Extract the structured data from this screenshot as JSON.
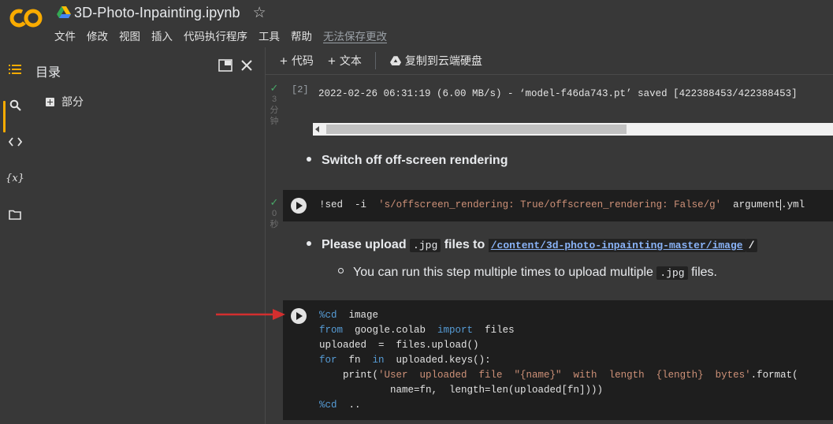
{
  "header": {
    "title": "3D-Photo-Inpainting.ipynb",
    "menu": [
      "文件",
      "修改",
      "视图",
      "插入",
      "代码执行程序",
      "工具",
      "帮助"
    ],
    "unsaved_label": "无法保存更改"
  },
  "toc": {
    "title": "目录",
    "items": [
      {
        "label": "部分"
      }
    ]
  },
  "toolbar": {
    "add_code": "代码",
    "add_text": "文本",
    "copy_to_drive": "复制到云端硬盘"
  },
  "cells": {
    "output_cell": {
      "status_lines": [
        "3",
        "分",
        "钟"
      ],
      "exec_count": "[2]",
      "output_text": "2022-02-26 06:31:19 (6.00 MB/s) - ‘model-f46da743.pt’ saved [422388453/422388453]"
    },
    "md1": {
      "bullet": "Switch off off-screen rendering"
    },
    "sed_cell": {
      "status_lines": [
        "0",
        "秒"
      ],
      "code_cmd": "!sed",
      "code_flag": "-i",
      "code_str": "'s/offscreen_rendering: True/offscreen_rendering: False/g'",
      "code_file_a": "argument",
      "code_file_b": ".yml"
    },
    "md2": {
      "prefix": "Please upload",
      "ext": ".jpg",
      "middle": "files to",
      "link": "/content/3d-photo-inpainting-master/image",
      "suffix": "/",
      "sub_prefix": "You can run this step multiple times to upload multiple",
      "sub_ext": ".jpg",
      "sub_suffix": "files."
    },
    "upload_cell": {
      "lines": [
        [
          {
            "t": "%cd",
            "c": "kw"
          },
          {
            "t": "  image",
            "c": ""
          }
        ],
        [
          {
            "t": "from",
            "c": "kw"
          },
          {
            "t": "  google.colab  ",
            "c": ""
          },
          {
            "t": "import",
            "c": "kw"
          },
          {
            "t": "  files",
            "c": ""
          }
        ],
        [
          {
            "t": "uploaded  =  files.upload()",
            "c": ""
          }
        ],
        [
          {
            "t": "for",
            "c": "kw"
          },
          {
            "t": "  fn  ",
            "c": ""
          },
          {
            "t": "in",
            "c": "kw"
          },
          {
            "t": "  uploaded.keys():",
            "c": ""
          }
        ],
        [
          {
            "t": "    print(",
            "c": ""
          },
          {
            "t": "'User  uploaded  file  \"{name}\"  with  length  {length}  bytes'",
            "c": "str"
          },
          {
            "t": ".format(",
            "c": ""
          }
        ],
        [
          {
            "t": "            name=fn,  length=len(uploaded[fn])))",
            "c": ""
          }
        ],
        [
          {
            "t": "%cd",
            "c": "kw"
          },
          {
            "t": "  ..",
            "c": ""
          }
        ]
      ]
    }
  },
  "colors": {
    "background": "#383838",
    "code_background": "#1e1e1e",
    "keyword": "#569cd6",
    "string": "#ce9178",
    "link": "#8ab4f8",
    "accent": "#f9ab00",
    "arrow": "#d32f2f",
    "success": "#48a868"
  }
}
